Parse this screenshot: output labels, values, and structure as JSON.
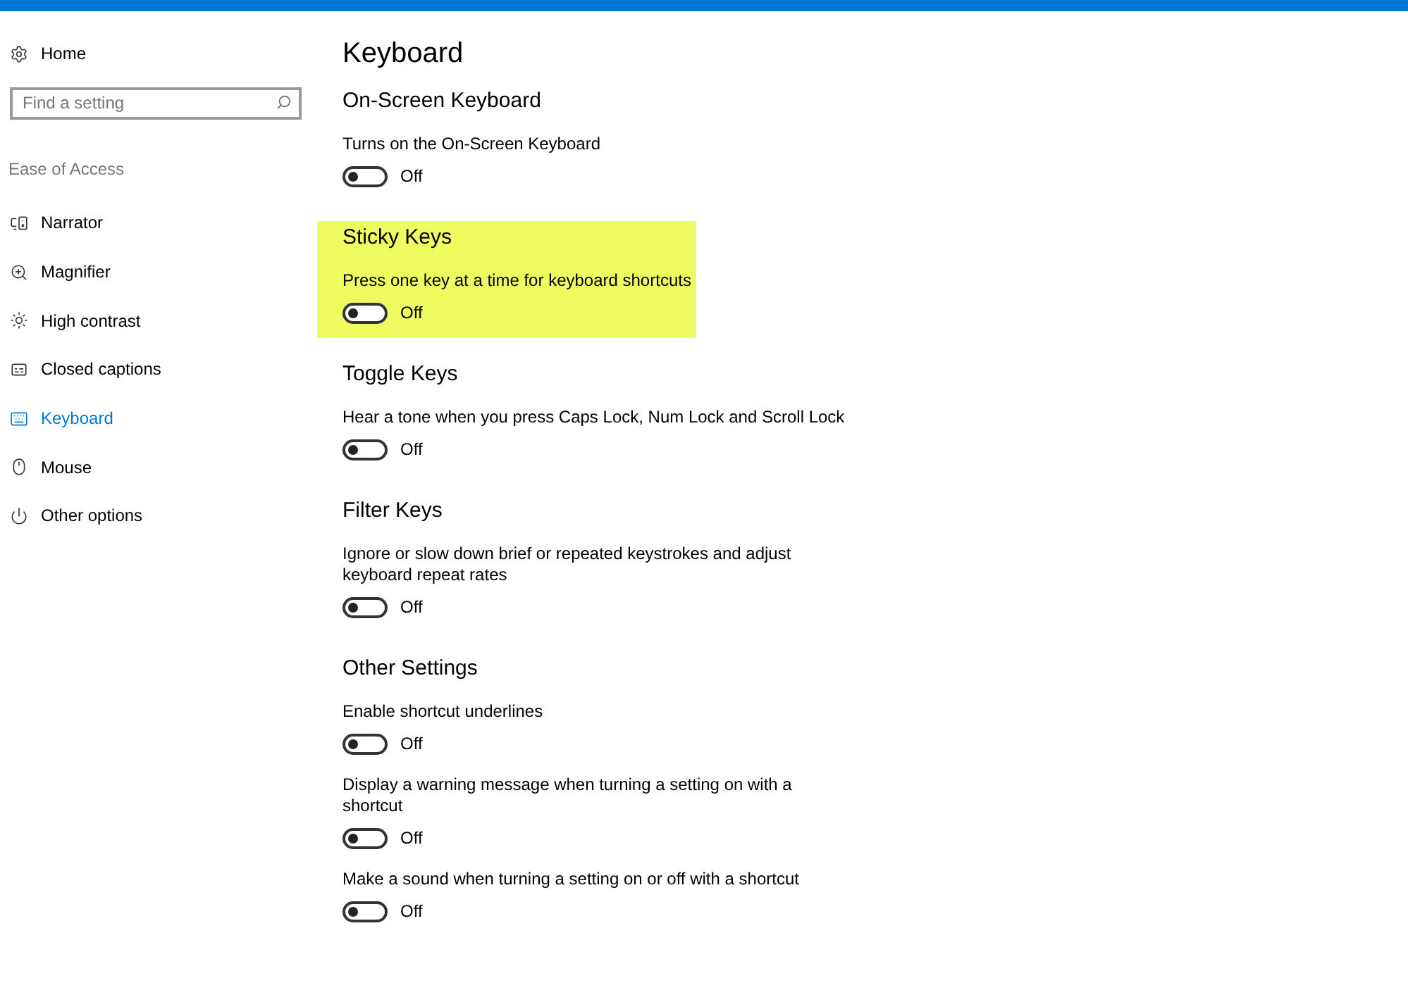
{
  "sidebar": {
    "home": {
      "label": "Home"
    },
    "search": {
      "placeholder": "Find a setting"
    },
    "group_label": "Ease of Access",
    "items": [
      {
        "kind": "narrator",
        "label": "Narrator",
        "selected": false
      },
      {
        "kind": "magnifier",
        "label": "Magnifier",
        "selected": false
      },
      {
        "kind": "contrast",
        "label": "High contrast",
        "selected": false
      },
      {
        "kind": "captions",
        "label": "Closed captions",
        "selected": false
      },
      {
        "kind": "keyboard",
        "label": "Keyboard",
        "selected": true
      },
      {
        "kind": "mouse",
        "label": "Mouse",
        "selected": false
      },
      {
        "kind": "other",
        "label": "Other options",
        "selected": false
      }
    ]
  },
  "page_title": "Keyboard",
  "sections": [
    {
      "title": "On-Screen Keyboard",
      "highlighted": false,
      "settings": [
        {
          "description": "Turns on the On-Screen Keyboard",
          "on": false,
          "state_label": "Off"
        }
      ]
    },
    {
      "title": "Sticky Keys",
      "highlighted": true,
      "settings": [
        {
          "description": "Press one key at a time for keyboard shortcuts",
          "on": false,
          "state_label": "Off"
        }
      ]
    },
    {
      "title": "Toggle Keys",
      "highlighted": false,
      "settings": [
        {
          "description": "Hear a tone when you press Caps Lock, Num Lock and Scroll Lock",
          "on": false,
          "state_label": "Off"
        }
      ]
    },
    {
      "title": "Filter Keys",
      "highlighted": false,
      "settings": [
        {
          "description": "Ignore or slow down brief or repeated keystrokes and adjust keyboard repeat rates",
          "on": false,
          "state_label": "Off"
        }
      ]
    },
    {
      "title": "Other Settings",
      "highlighted": false,
      "settings": [
        {
          "description": "Enable shortcut underlines",
          "on": false,
          "state_label": "Off"
        },
        {
          "description": "Display a warning message when turning a setting on with a shortcut",
          "on": false,
          "state_label": "Off"
        },
        {
          "description": "Make a sound when turning a setting on or off with a shortcut",
          "on": false,
          "state_label": "Off"
        }
      ]
    }
  ]
}
